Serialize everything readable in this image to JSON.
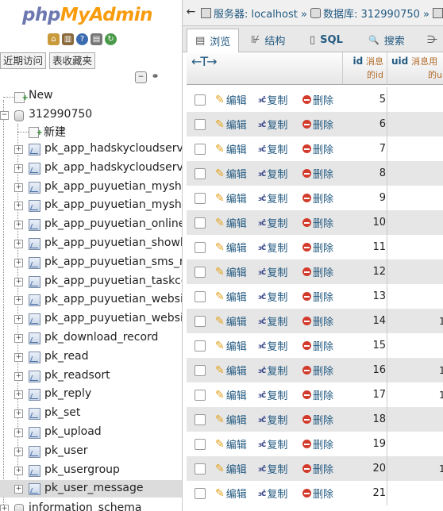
{
  "logo": {
    "part1": "php",
    "part2": "MyAdmin"
  },
  "nav_tabs": [
    "近期访问",
    "表收藏夹"
  ],
  "tree": {
    "new_label": "New",
    "db_name": "312990750",
    "db_new_label": "新建",
    "tables": [
      "pk_app_hadskycloudserver_",
      "pk_app_hadskycloudserver_",
      "pk_app_puyuetian_myshop_",
      "pk_app_puyuetian_myshop_",
      "pk_app_puyuetian_onlineus",
      "pk_app_puyuetian_showlink",
      "pk_app_puyuetian_sms_reco",
      "pk_app_puyuetian_taskcent",
      "pk_app_puyuetian_websitep",
      "pk_app_puyuetian_websitep",
      "pk_download_record",
      "pk_read",
      "pk_readsort",
      "pk_reply",
      "pk_set",
      "pk_upload",
      "pk_user",
      "pk_usergroup",
      "pk_user_message"
    ],
    "next_db": "information_schema"
  },
  "breadcrumb": {
    "back": "←",
    "server": "服务器: localhost »",
    "database": "数据库: 312990750 »"
  },
  "tabs": [
    {
      "label": "浏览",
      "icon": "browse-icon",
      "glyph": "▤"
    },
    {
      "label": "结构",
      "icon": "structure-icon",
      "glyph": "⊮"
    },
    {
      "label": "SQL",
      "icon": "sql-icon",
      "glyph": "▯"
    },
    {
      "label": "搜索",
      "icon": "search-icon",
      "glyph": "🔍"
    },
    {
      "label": "",
      "icon": "insert-icon",
      "glyph": "⋺"
    }
  ],
  "table_header": {
    "arrows": "←T→",
    "id_col": "id",
    "id_desc_1": "消息",
    "id_desc_2": "的id",
    "uid_col": "uid",
    "uid_desc_1": "消息用",
    "uid_desc_2": "的u"
  },
  "row_actions": {
    "edit": "编辑",
    "copy": "复制",
    "delete": "删除"
  },
  "rows": [
    {
      "id": "5",
      "uid": ""
    },
    {
      "id": "6",
      "uid": ""
    },
    {
      "id": "7",
      "uid": ""
    },
    {
      "id": "8",
      "uid": ""
    },
    {
      "id": "9",
      "uid": ""
    },
    {
      "id": "10",
      "uid": ""
    },
    {
      "id": "11",
      "uid": ""
    },
    {
      "id": "12",
      "uid": ""
    },
    {
      "id": "13",
      "uid": ""
    },
    {
      "id": "14",
      "uid": "1"
    },
    {
      "id": "15",
      "uid": ""
    },
    {
      "id": "16",
      "uid": "1"
    },
    {
      "id": "17",
      "uid": "1"
    },
    {
      "id": "18",
      "uid": ""
    },
    {
      "id": "19",
      "uid": ""
    },
    {
      "id": "20",
      "uid": "1"
    },
    {
      "id": "21",
      "uid": ""
    }
  ],
  "colors": {
    "link": "#235a81",
    "logo_php": "#6c78af",
    "logo_my": "#f89c0e",
    "row_alt": "#e6e6e6"
  }
}
